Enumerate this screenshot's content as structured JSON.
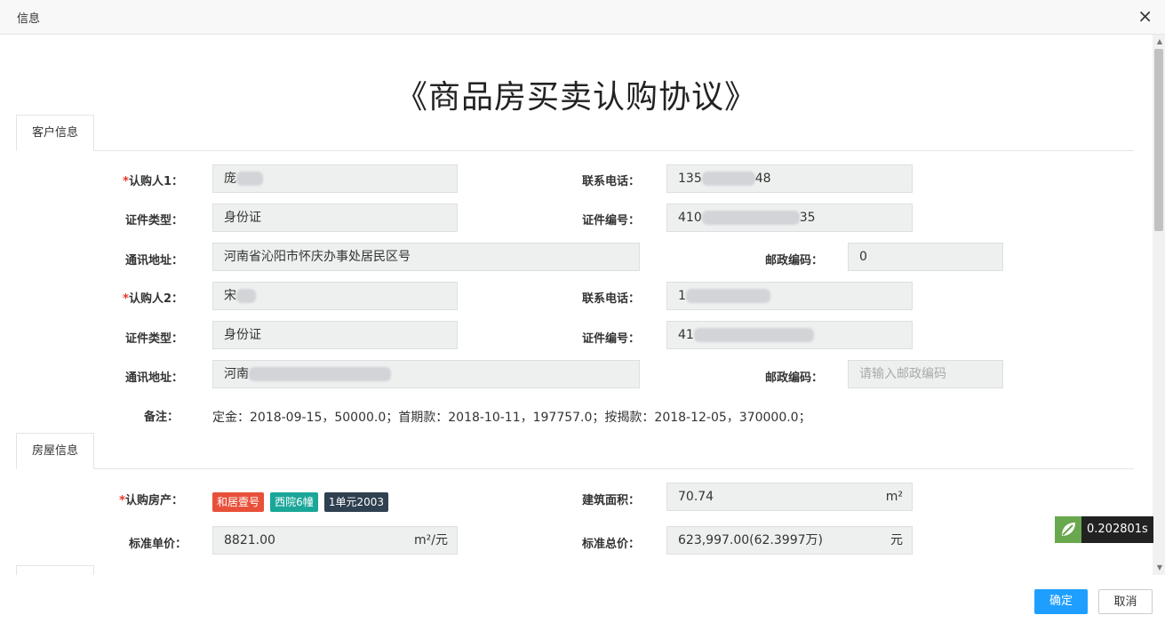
{
  "dialog": {
    "title": "信息",
    "close_label": "×"
  },
  "doc_title": "《商品房买卖认购协议》",
  "tabs": {
    "customer": "客户信息",
    "house": "房屋信息"
  },
  "customer": {
    "buyer1": {
      "label": "认购人1：",
      "value": "庞"
    },
    "phone1": {
      "label": "联系电话：",
      "value_start": "135",
      "value_end": "48"
    },
    "idtype1": {
      "label": "证件类型：",
      "value": "身份证"
    },
    "idno1": {
      "label": "证件编号：",
      "value_start": "410",
      "value_end": "35"
    },
    "addr1": {
      "label": "通讯地址：",
      "value": "河南省沁阳市怀庆办事处居民区号"
    },
    "zip1": {
      "label": "邮政编码：",
      "value": "0"
    },
    "buyer2": {
      "label": "认购人2：",
      "value": "宋"
    },
    "phone2": {
      "label": "联系电话：",
      "value_start": "1"
    },
    "idtype2": {
      "label": "证件类型：",
      "value": "身份证"
    },
    "idno2": {
      "label": "证件编号：",
      "value_start": "41"
    },
    "addr2": {
      "label": "通讯地址：",
      "value": "河南"
    },
    "zip2": {
      "label": "邮政编码：",
      "placeholder": "请输入邮政编码"
    },
    "remark": {
      "label": "备注：",
      "value": "定金：2018-09-15，50000.0；首期款：2018-10-11，197757.0；按揭款：2018-12-05，370000.0；"
    }
  },
  "house": {
    "property": {
      "label": "认购房产：",
      "tags": [
        "和居壹号",
        "西院6幢",
        "1单元2003"
      ]
    },
    "area": {
      "label": "建筑面积：",
      "value": "70.74",
      "unit": "m²"
    },
    "unit_price": {
      "label": "标准单价：",
      "value": "8821.00",
      "unit": "m²/元"
    },
    "total_price": {
      "label": "标准总价：",
      "value": "623,997.00(62.3997万)",
      "unit": "元"
    }
  },
  "timer": {
    "value": "0.202801s"
  },
  "buttons": {
    "ok": "确定",
    "cancel": "取消"
  },
  "colors": {
    "primary": "#1e9fff",
    "tag_red": "#e8503a",
    "tag_teal": "#1aa799",
    "tag_dark": "#2f4050",
    "required": "#e32"
  }
}
